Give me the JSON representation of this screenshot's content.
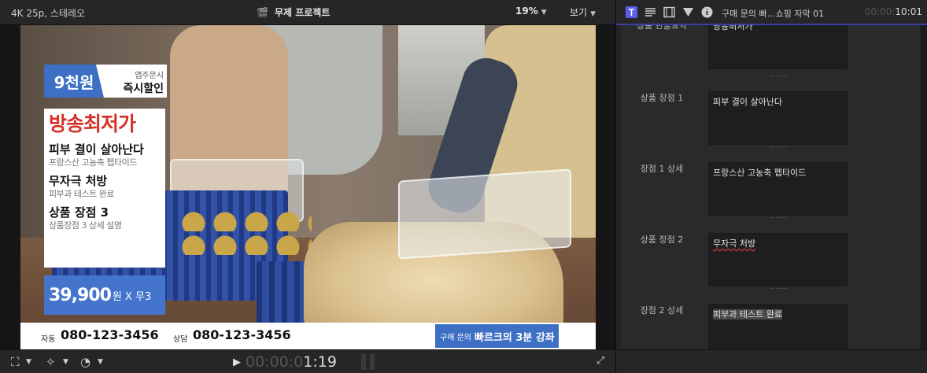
{
  "viewer": {
    "format": "4K 25p, 스테레오",
    "project_name": "무제 프로젝트",
    "zoom": "19%",
    "view_menu": "보기"
  },
  "overlay": {
    "tag_price": "9천원",
    "tag_small": "앱주문시",
    "tag_big": "즉시할인",
    "hero": "방송최저가",
    "points": [
      {
        "title": "피부 결이 살아난다",
        "sub": "프랑스산 고농축 펩타이드"
      },
      {
        "title": "무자극 처방",
        "sub": "피부과 테스트 완료"
      },
      {
        "title": "상품 장점 3",
        "sub": "상품장점 3 상세 설명"
      }
    ],
    "price": "39,900",
    "price_rest": "원 X 무3",
    "phone1_label": "자동",
    "phone1": "080-123-3456",
    "phone2_label": "상담",
    "phone2": "080-123-3456",
    "cta_small": "구매 문의",
    "cta_big": "빠르크의 3분 강좌"
  },
  "playback": {
    "timecode_dim": "00:00:0",
    "timecode_lit": "1:19"
  },
  "inspector": {
    "title": "구매 문의 빠…쇼핑 자막 01",
    "timecode_dim": "00:00:",
    "timecode_lit": "10:01",
    "rows": [
      {
        "label": "상품 한줄요약",
        "value": "방송최저가"
      },
      {
        "label": "상품 장점 1",
        "value": "피부 결이 살아난다"
      },
      {
        "label": "장점 1 상세",
        "value": "프랑스산 고농축 펩타이드"
      },
      {
        "label": "상품 장점 2",
        "value": "무자극 처방"
      },
      {
        "label": "장점 2 상세",
        "value": "피부과 테스트 완료"
      }
    ]
  },
  "colors": {
    "accent_blue": "#3d6fc4",
    "hero_red": "#d5302a",
    "inspector_accent": "#3b3ea8"
  }
}
